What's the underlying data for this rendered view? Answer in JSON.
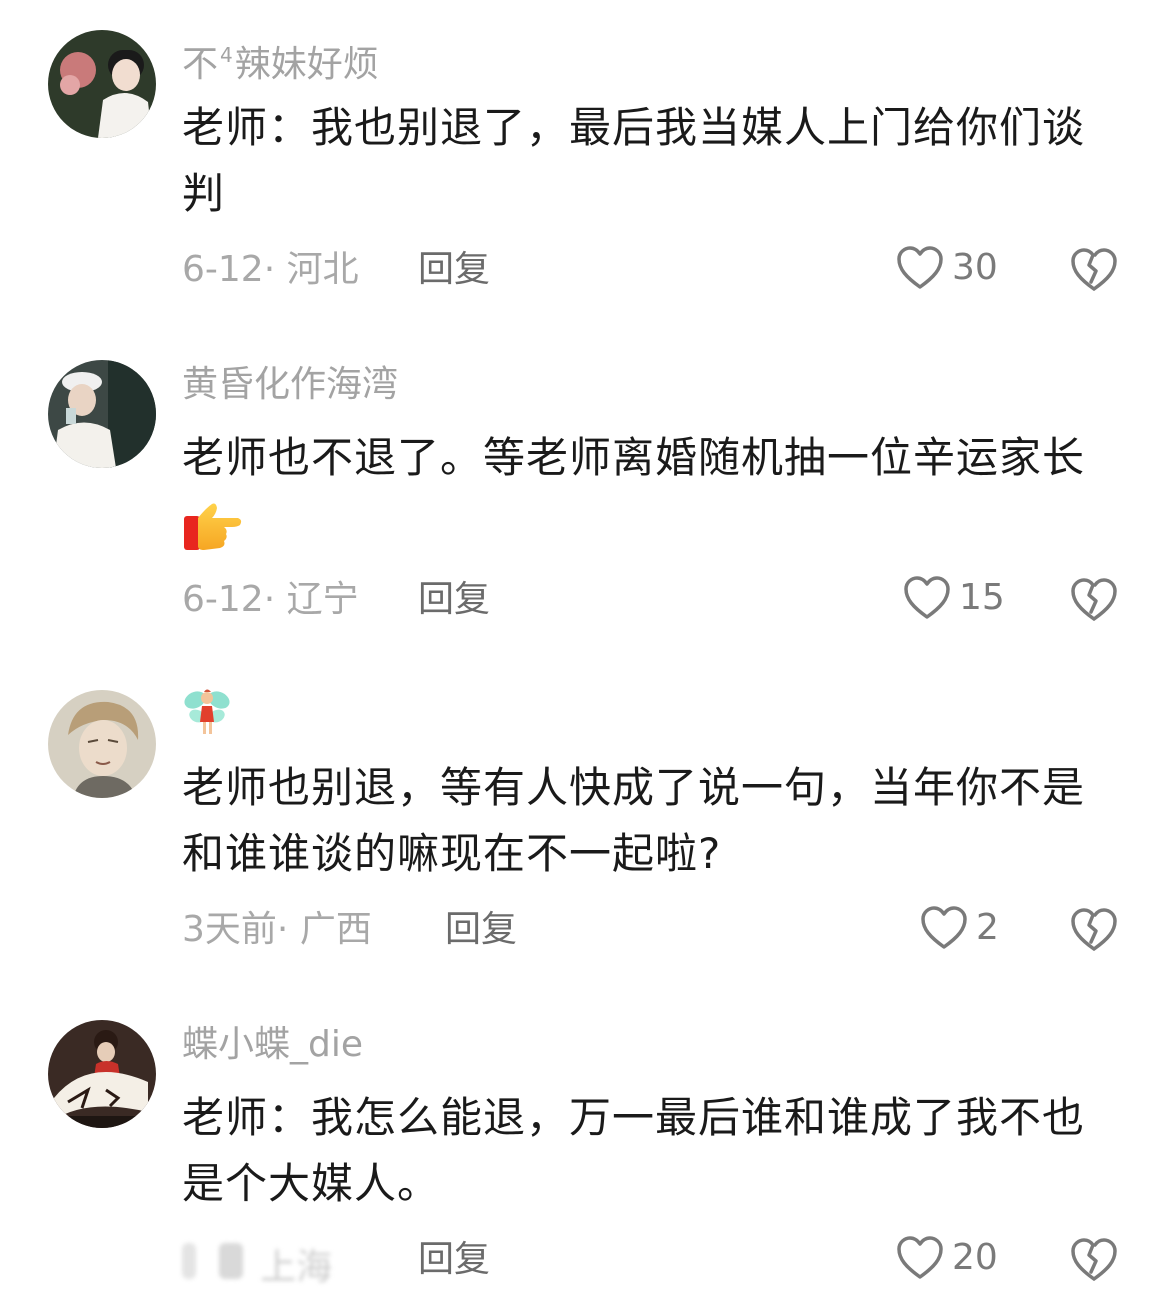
{
  "comments": [
    {
      "username": "不",
      "username_sup": "4",
      "username_rest": "辣妹好烦",
      "content": "老师：我也别退了，最后我当媒人上门给你们谈判",
      "date": "6-12",
      "location": "河北",
      "reply_label": "回复",
      "likes": "30"
    },
    {
      "username": "黄昏化作海湾",
      "content": "老师也不退了。等老师离婚随机抽一位辛运家长",
      "emoji": "pointing-right-hand",
      "date": "6-12",
      "location": "辽宁",
      "reply_label": "回复",
      "likes": "15"
    },
    {
      "username_emoji": "fairy",
      "content": "老师也别退，等有人快成了说一句，当年你不是和谁谁谈的嘛现在不一起啦?",
      "date": "3天前",
      "location": "广西",
      "reply_label": "回复",
      "likes": "2"
    },
    {
      "username": "蝶小蝶_die",
      "content": "老师：我怎么能退，万一最后谁和谁成了我不也是个大媒人。",
      "location": "上海",
      "reply_label": "回复",
      "likes": "20"
    }
  ],
  "meta_separator": "·",
  "colors": {
    "username": "#a3a3a3",
    "content": "#1a1a1a",
    "meta": "#a8a8a8",
    "reply": "#6b6b6b",
    "icon": "#7a7a7a"
  }
}
